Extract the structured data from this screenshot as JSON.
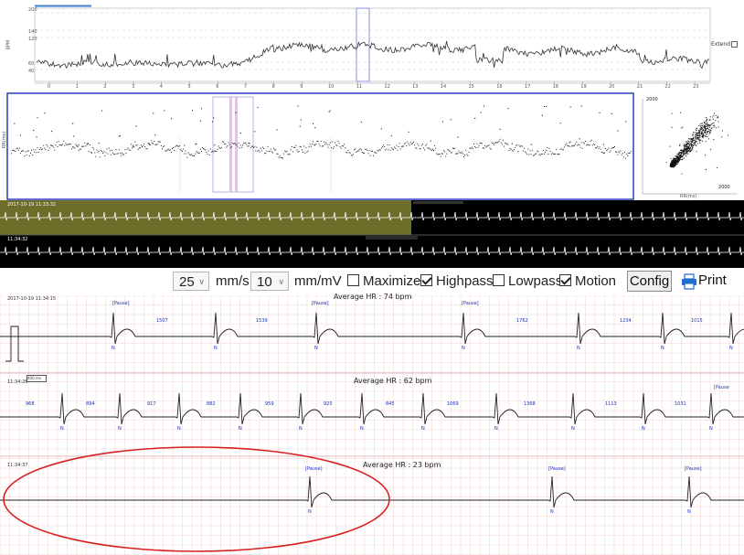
{
  "trend": {
    "y_ticks": [
      "200",
      "140",
      "120",
      "60",
      "40"
    ],
    "y_label": "BPM",
    "hours": [
      "0",
      "1",
      "2",
      "3",
      "4",
      "5",
      "6",
      "7",
      "8",
      "9",
      "10",
      "11",
      "12",
      "13",
      "14",
      "15",
      "16",
      "17",
      "18",
      "19",
      "20",
      "21",
      "22",
      "23"
    ],
    "checkbox_label": "Extend"
  },
  "rr_panel": {
    "y_label": "RR(ms)"
  },
  "scatter": {
    "top_label": "2000",
    "bottom_label": "2000",
    "x_label": "RR(ms)"
  },
  "strips": {
    "strip1_timestamp": "2017-10-19 11:33:32",
    "strip2_timestamp": "11:34:32"
  },
  "toolbar": {
    "speed_value": "25",
    "speed_unit": "mm/s",
    "gain_value": "10",
    "gain_unit": "mm/mV",
    "maximize_label": "Maximize",
    "maximize_checked": false,
    "highpass_label": "Highpass",
    "highpass_checked": true,
    "lowpass_label": "Lowpass",
    "lowpass_checked": false,
    "motion_label": "Motion",
    "motion_checked": true,
    "config_label": "Config",
    "print_label": "Print"
  },
  "ecg": {
    "row1": {
      "timestamp": "2017-10-19 11:34:15",
      "avg_hr": "Average HR : 74 bpm",
      "pause_labels": [
        "Pause",
        "Pause",
        "Pause"
      ],
      "intervals": [
        "1507",
        "1539",
        "1762",
        "1234",
        "1015"
      ]
    },
    "row2": {
      "timestamp": "11:34:26",
      "scale_label": "400 ms",
      "avg_hr": "Average HR : 62 bpm",
      "pause_labels": [
        "Pause"
      ],
      "intervals": [
        "968",
        "894",
        "917",
        "882",
        "959",
        "925",
        "845",
        "1069",
        "1368",
        "1113",
        "1031"
      ]
    },
    "row3": {
      "timestamp": "11:34:37",
      "avg_hr": "Average HR : 23 bpm",
      "pause_labels": [
        "Pause",
        "Pause",
        "Pause"
      ]
    },
    "beat_label": "N"
  },
  "colors": {
    "trend_box": "#2a3fc7",
    "strip_highlight": "#6e6d2a",
    "selection_pink": "#f3a9e5",
    "ecg_grid": "#f2c6c6",
    "annotation_blue": "#1b2fbf",
    "circle_red": "#d81f1f"
  }
}
